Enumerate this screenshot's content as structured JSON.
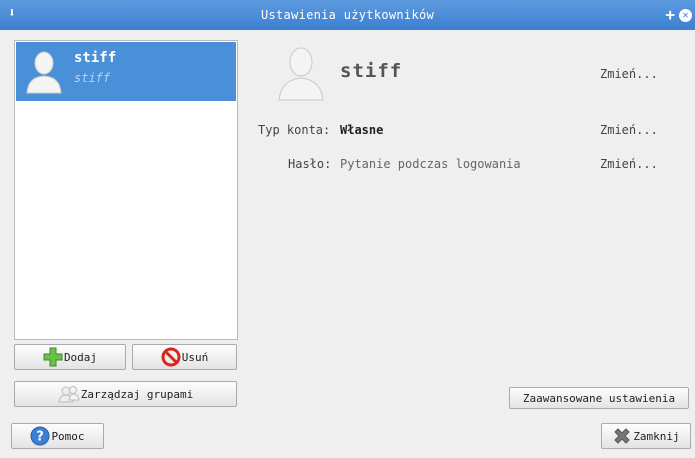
{
  "window": {
    "title": "Ustawienia użytkowników"
  },
  "users": [
    {
      "name": "stiff",
      "login": "stiff"
    }
  ],
  "buttons": {
    "add": "Dodaj",
    "remove": "Usuń",
    "manage_groups": "Zarządzaj grupami",
    "help": "Pomoc",
    "advanced": "Zaawansowane ustawienia",
    "close": "Zamknij"
  },
  "details": {
    "name": "stiff",
    "change_name": "Zmień...",
    "account_type_label": "Typ konta:",
    "account_type_value": "Własne",
    "change_account_type": "Zmień...",
    "password_label": "Hasło:",
    "password_value": "Pytanie podczas logowania",
    "change_password": "Zmień..."
  },
  "colors": {
    "titlebar": "#4a8cd9",
    "selection": "#4a90d9"
  },
  "icons": [
    "window-menu-icon",
    "maximize-icon",
    "close-icon",
    "user-avatar-icon",
    "add-icon",
    "remove-icon",
    "group-icon",
    "help-icon",
    "close-x-icon"
  ]
}
